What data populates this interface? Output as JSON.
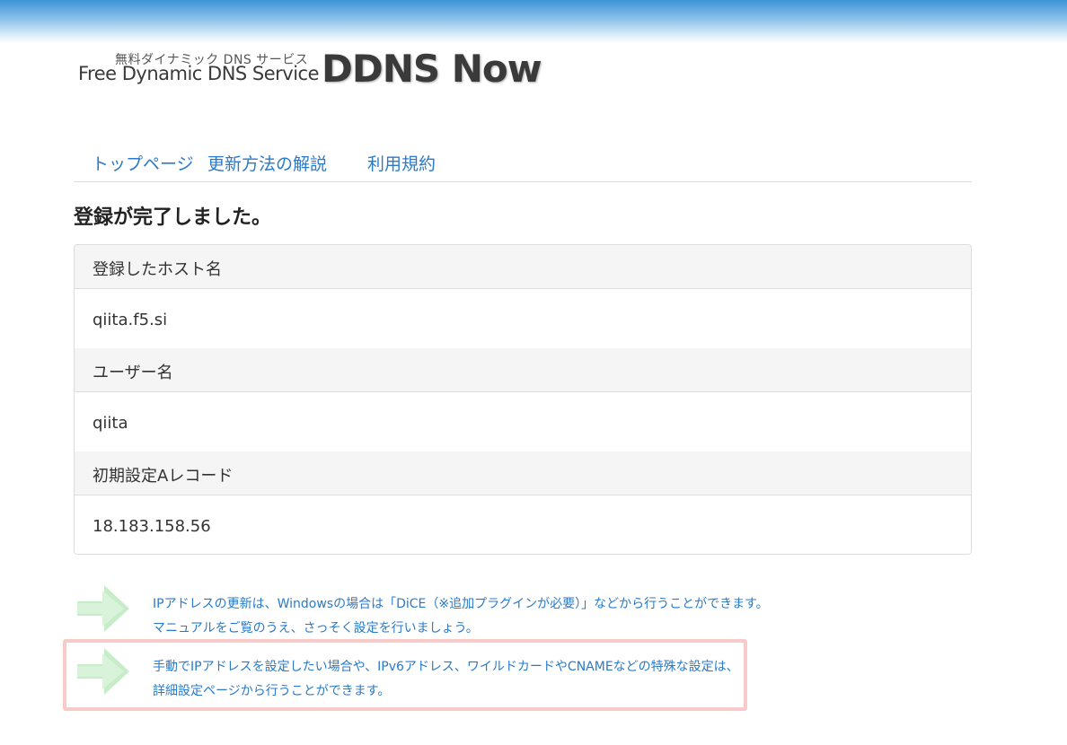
{
  "logo": {
    "subtitle": "無料ダイナミック DNS サービス",
    "service_name": "Free Dynamic DNS Service",
    "brand": "DDNS Now"
  },
  "nav": {
    "items": [
      {
        "label": "トップページ"
      },
      {
        "label": "更新方法の解説"
      },
      {
        "label": "利用規約"
      }
    ]
  },
  "page": {
    "title": "登録が完了しました。"
  },
  "details": {
    "host_label": "登録したホスト名",
    "host_value": "qiita.f5.si",
    "user_label": "ユーザー名",
    "user_value": "qiita",
    "record_label": "初期設定Aレコード",
    "record_value": "18.183.158.56"
  },
  "notes": [
    {
      "line1": "IPアドレスの更新は、Windowsの場合は「DiCE（※追加プラグインが必要）」などから行うことができます。",
      "line2": "マニュアルをご覧のうえ、さっそく設定を行いましょう。"
    },
    {
      "line1": "手動でIPアドレスを設定したい場合や、IPv6アドレス、ワイルドカードやCNAMEなどの特殊な設定は、",
      "line2": "詳細設定ページから行うことができます。"
    }
  ],
  "colors": {
    "link": "#2a7ac8",
    "arrow": "#c6ecc8",
    "highlight_border": "#f8caca",
    "topbar": "#3c95d6"
  },
  "icons": {
    "note_arrow": "arrow-right-icon"
  }
}
